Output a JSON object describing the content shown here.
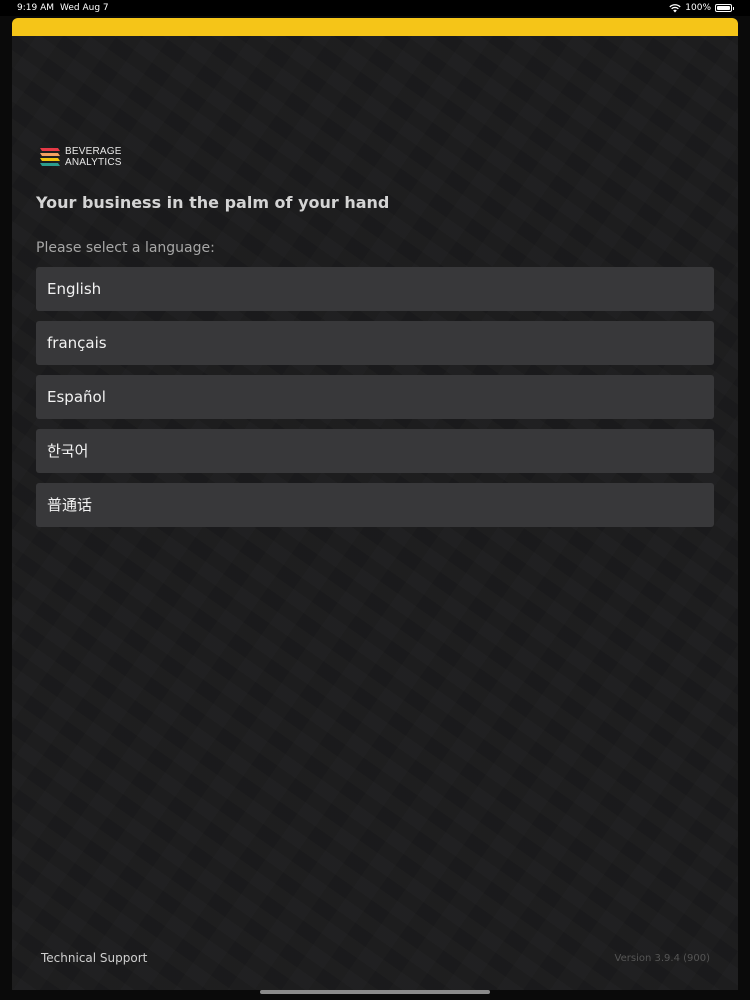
{
  "status_bar": {
    "time": "9:19 AM",
    "date": "Wed Aug 7",
    "battery": "100%"
  },
  "colors": {
    "accent": "#f5c518",
    "background": "#1b1b1c",
    "option_background": "#38383a"
  },
  "logo": {
    "line1": "BEVERAGE",
    "line2": "ANALYTICS"
  },
  "tagline": "Your business in the palm of your hand",
  "language_prompt": "Please select a language:",
  "languages": [
    "English",
    "français",
    "Español",
    "한국어",
    "普通话"
  ],
  "footer": {
    "support_label": "Technical Support",
    "version": "Version 3.9.4 (900)"
  }
}
